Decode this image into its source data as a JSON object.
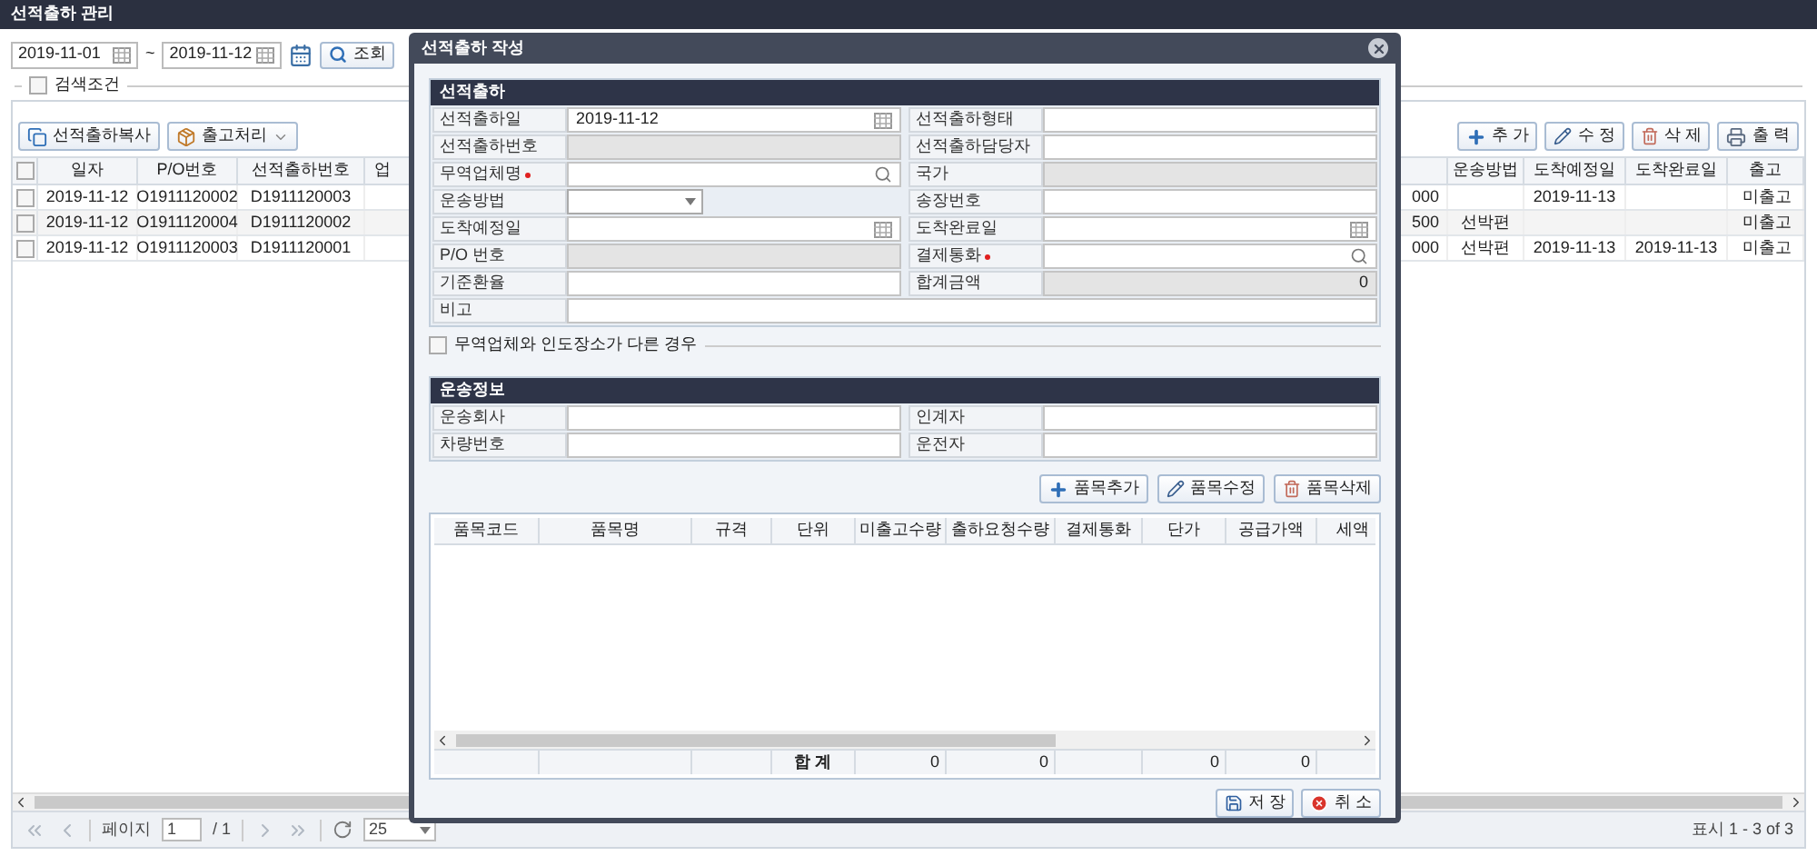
{
  "page": {
    "title": "선적출하 관리"
  },
  "filter": {
    "date_from": "2019-11-01",
    "separator": "~",
    "date_to": "2019-11-12",
    "search_button": "조회",
    "search_conditions": {
      "label": "검색조건",
      "checked": false
    }
  },
  "toolbar_left": [
    {
      "label": "선적출하복사",
      "kind": "copy"
    },
    {
      "label": "출고처리",
      "kind": "dropdown"
    }
  ],
  "toolbar_right": [
    {
      "label": "추 가",
      "kind": "add"
    },
    {
      "label": "수 정",
      "kind": "edit"
    },
    {
      "label": "삭 제",
      "kind": "delete"
    },
    {
      "label": "출 력",
      "kind": "print"
    }
  ],
  "table": {
    "select_all": {
      "checked": false
    },
    "columns": [
      {
        "label": "일자"
      },
      {
        "label": "P/O번호"
      },
      {
        "label": "선적출하번호"
      },
      {
        "label": "업"
      },
      {},
      {
        "label": "운송방법"
      },
      {
        "label": "도착예정일"
      },
      {
        "label": "도착완료일"
      },
      {
        "label": "출고"
      }
    ],
    "rows": [
      {
        "checked": false,
        "cells": [
          "2019-11-12",
          "O1911120002",
          "D1911120003",
          null,
          "000",
          null,
          "2019-11-13",
          null,
          "미출고"
        ]
      },
      {
        "checked": false,
        "cells": [
          "2019-11-12",
          "O1911120004",
          "D1911120002",
          null,
          "500",
          "선박편",
          null,
          null,
          "미출고"
        ]
      },
      {
        "checked": false,
        "cells": [
          "2019-11-12",
          "O1911120003",
          "D1911120001",
          null,
          "000",
          "선박편",
          "2019-11-13",
          "2019-11-13",
          "미출고"
        ]
      }
    ]
  },
  "pager": {
    "page_label": "페이지",
    "page": "1",
    "total": "/ 1",
    "page_size": "25",
    "summary": "표시 1 - 3 of 3"
  },
  "dialog": {
    "title": "선적출하 작성",
    "shipment_section": {
      "title": "선적출하",
      "fields": [
        {
          "label": "선적출하일",
          "kind": "date",
          "value": "2019-11-12",
          "required": false
        },
        {
          "label": "선적출하형태",
          "kind": "text",
          "required": false
        },
        {
          "label": "선적출하번호",
          "kind": "readonly",
          "required": false
        },
        {
          "label": "선적출하담당자",
          "kind": "text",
          "required": false
        },
        {
          "label": "무역업체명",
          "kind": "search",
          "required": true
        },
        {
          "label": "국가",
          "kind": "readonly",
          "required": false
        },
        {
          "label": "운송방법",
          "kind": "select",
          "required": false
        },
        {
          "label": "송장번호",
          "kind": "text",
          "required": false
        },
        {
          "label": "도착예정일",
          "kind": "date",
          "required": false
        },
        {
          "label": "도착완료일",
          "kind": "date",
          "required": false
        },
        {
          "label": "P/O 번호",
          "kind": "readonly",
          "required": false
        },
        {
          "label": "결제통화",
          "kind": "search",
          "required": true
        },
        {
          "label": "기준환율",
          "kind": "text",
          "required": false
        },
        {
          "label": "합계금액",
          "kind": "readonly",
          "value": "0",
          "required": false
        },
        {
          "label": "비고",
          "kind": "wide",
          "required": false
        }
      ]
    },
    "different_location": {
      "label": "무역업체와 인도장소가 다른 경우",
      "checked": false
    },
    "transport_section": {
      "title": "운송정보",
      "fields": [
        {
          "label": "운송회사",
          "kind": "text",
          "required": false
        },
        {
          "label": "인계자",
          "kind": "text",
          "required": false
        },
        {
          "label": "차량번호",
          "kind": "text",
          "required": false
        },
        {
          "label": "운전자",
          "kind": "text",
          "required": false
        }
      ]
    },
    "item_buttons": [
      {
        "label": "품목추가",
        "kind": "add"
      },
      {
        "label": "품목수정",
        "kind": "edit"
      },
      {
        "label": "품목삭제",
        "kind": "delete"
      }
    ],
    "items_table": {
      "columns": [
        "품목코드",
        "품목명",
        "규격",
        "단위",
        "미출고수량",
        "출하요청수량",
        "결제통화",
        "단가",
        "공급가액",
        "세액"
      ],
      "totals": [
        {
          "kind": "blank"
        },
        {
          "kind": "blank"
        },
        {
          "kind": "blank"
        },
        {
          "kind": "label",
          "text": "합 계"
        },
        {
          "kind": "value",
          "text": "0"
        },
        {
          "kind": "value",
          "text": "0"
        },
        {
          "kind": "blank"
        },
        {
          "kind": "value",
          "text": "0"
        },
        {
          "kind": "value",
          "text": "0"
        },
        {
          "kind": "blank"
        }
      ]
    },
    "buttons": [
      {
        "label": "저 장",
        "kind": "save"
      },
      {
        "label": "취 소",
        "kind": "cancel"
      }
    ]
  }
}
